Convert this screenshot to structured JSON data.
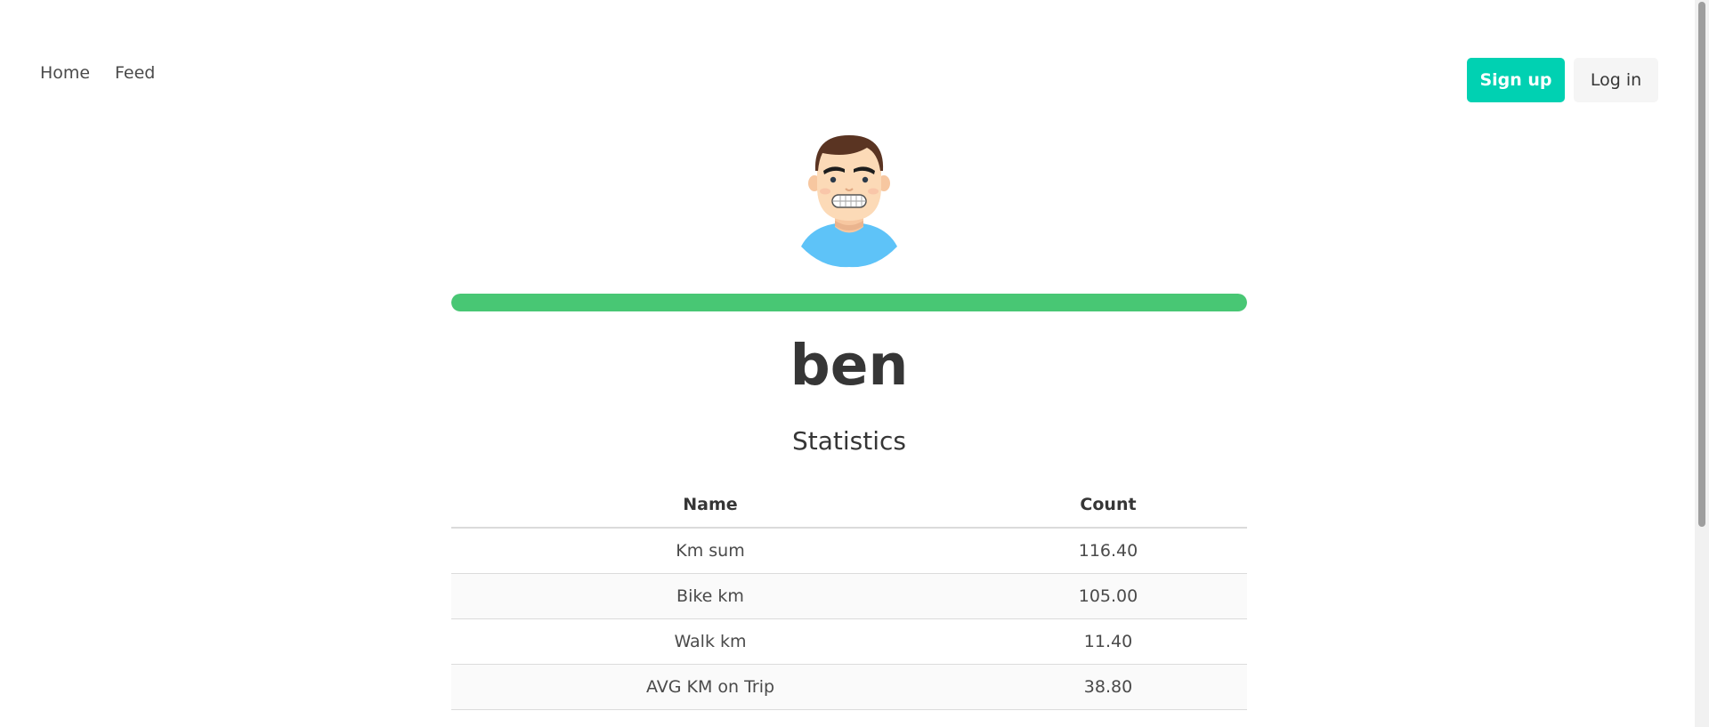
{
  "navbar": {
    "home_label": "Home",
    "feed_label": "Feed",
    "signup_label": "Sign up",
    "login_label": "Log in",
    "signup_color": "#00d1b2"
  },
  "profile": {
    "avatar_icon": "cartoon-man-avatar-icon",
    "progress_fraction": 1.0,
    "progress_color": "#48c774",
    "username": "ben",
    "statistics_heading": "Statistics"
  },
  "stats_table": {
    "headers": [
      "Name",
      "Count"
    ],
    "rows": [
      {
        "name": "Km sum",
        "count": "116.40"
      },
      {
        "name": "Bike km",
        "count": "105.00"
      },
      {
        "name": "Walk km",
        "count": "11.40"
      },
      {
        "name": "AVG KM on Trip",
        "count": "38.80"
      }
    ]
  }
}
